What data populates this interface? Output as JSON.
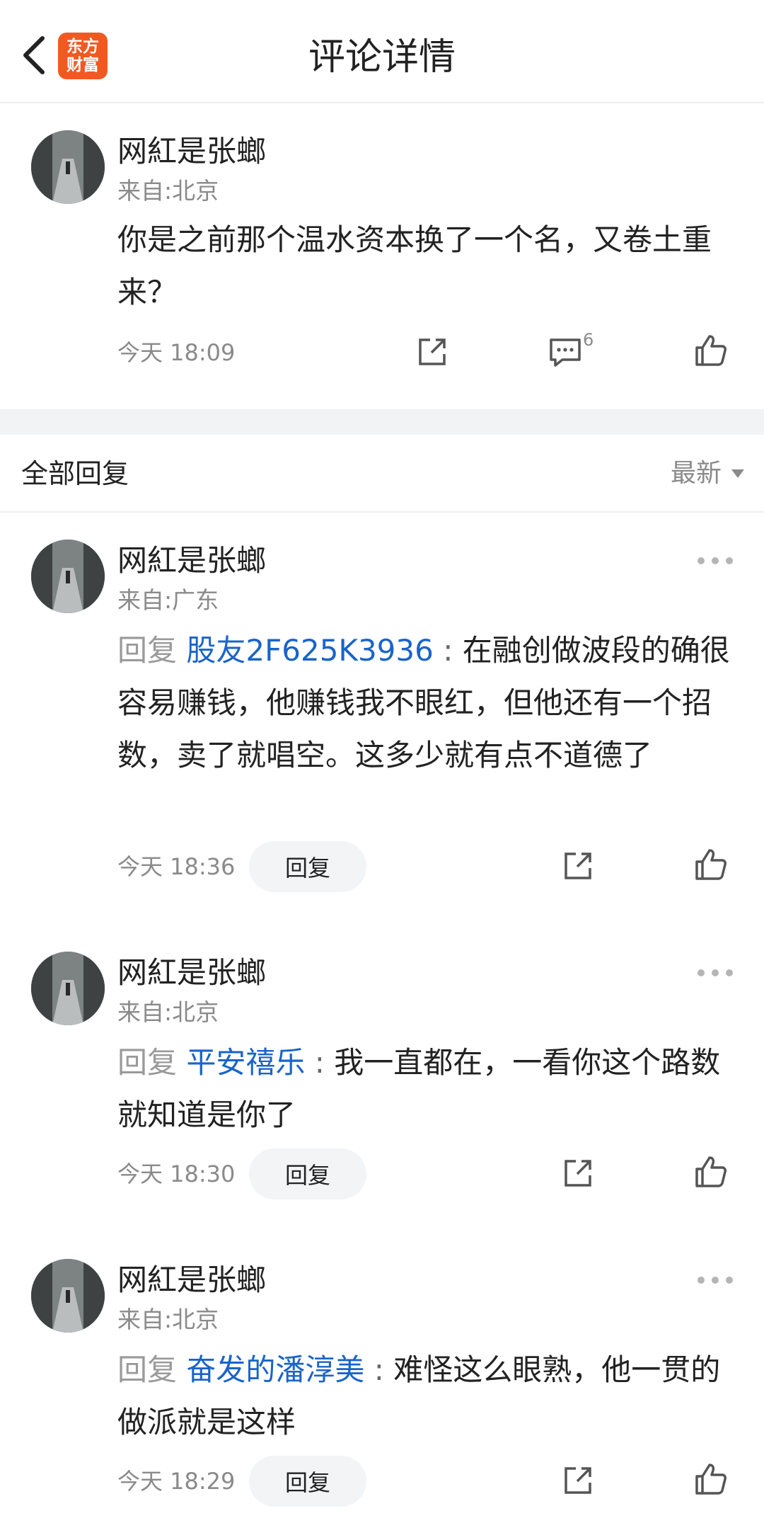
{
  "header": {
    "title": "评论详情",
    "logo_line1": "东方",
    "logo_line2": "财富",
    "back_icon": "chevron-left-icon"
  },
  "main_comment": {
    "user": "网紅是张螂",
    "location": "来自:北京",
    "text": "你是之前那个温水资本换了一个名，又卷土重来？",
    "time": "今天 18:09",
    "reply_count": "6"
  },
  "section": {
    "title": "全部回复",
    "sort": "最新"
  },
  "replies": [
    {
      "user": "网紅是张螂",
      "location": "来自:广东",
      "prefix": "回复",
      "target": "股友2F625K3936",
      "colon": " : ",
      "text": "在融创做波段的确很容易赚钱，他赚钱我不眼红，但他还有一个招数，卖了就唱空。这多少就有点不道德了",
      "time": "今天 18:36",
      "reply_label": "回复"
    },
    {
      "user": "网紅是张螂",
      "location": "来自:北京",
      "prefix": "回复",
      "target": "平安禧乐",
      "colon": " : ",
      "text": "我一直都在，一看你这个路数就知道是你了",
      "time": "今天 18:30",
      "reply_label": "回复"
    },
    {
      "user": "网紅是张螂",
      "location": "来自:北京",
      "prefix": "回复",
      "target": "奋发的潘淳美",
      "colon": " : ",
      "text": "难怪这么眼熟，他一贯的做派就是这样",
      "time": "今天 18:29",
      "reply_label": "回复"
    }
  ]
}
